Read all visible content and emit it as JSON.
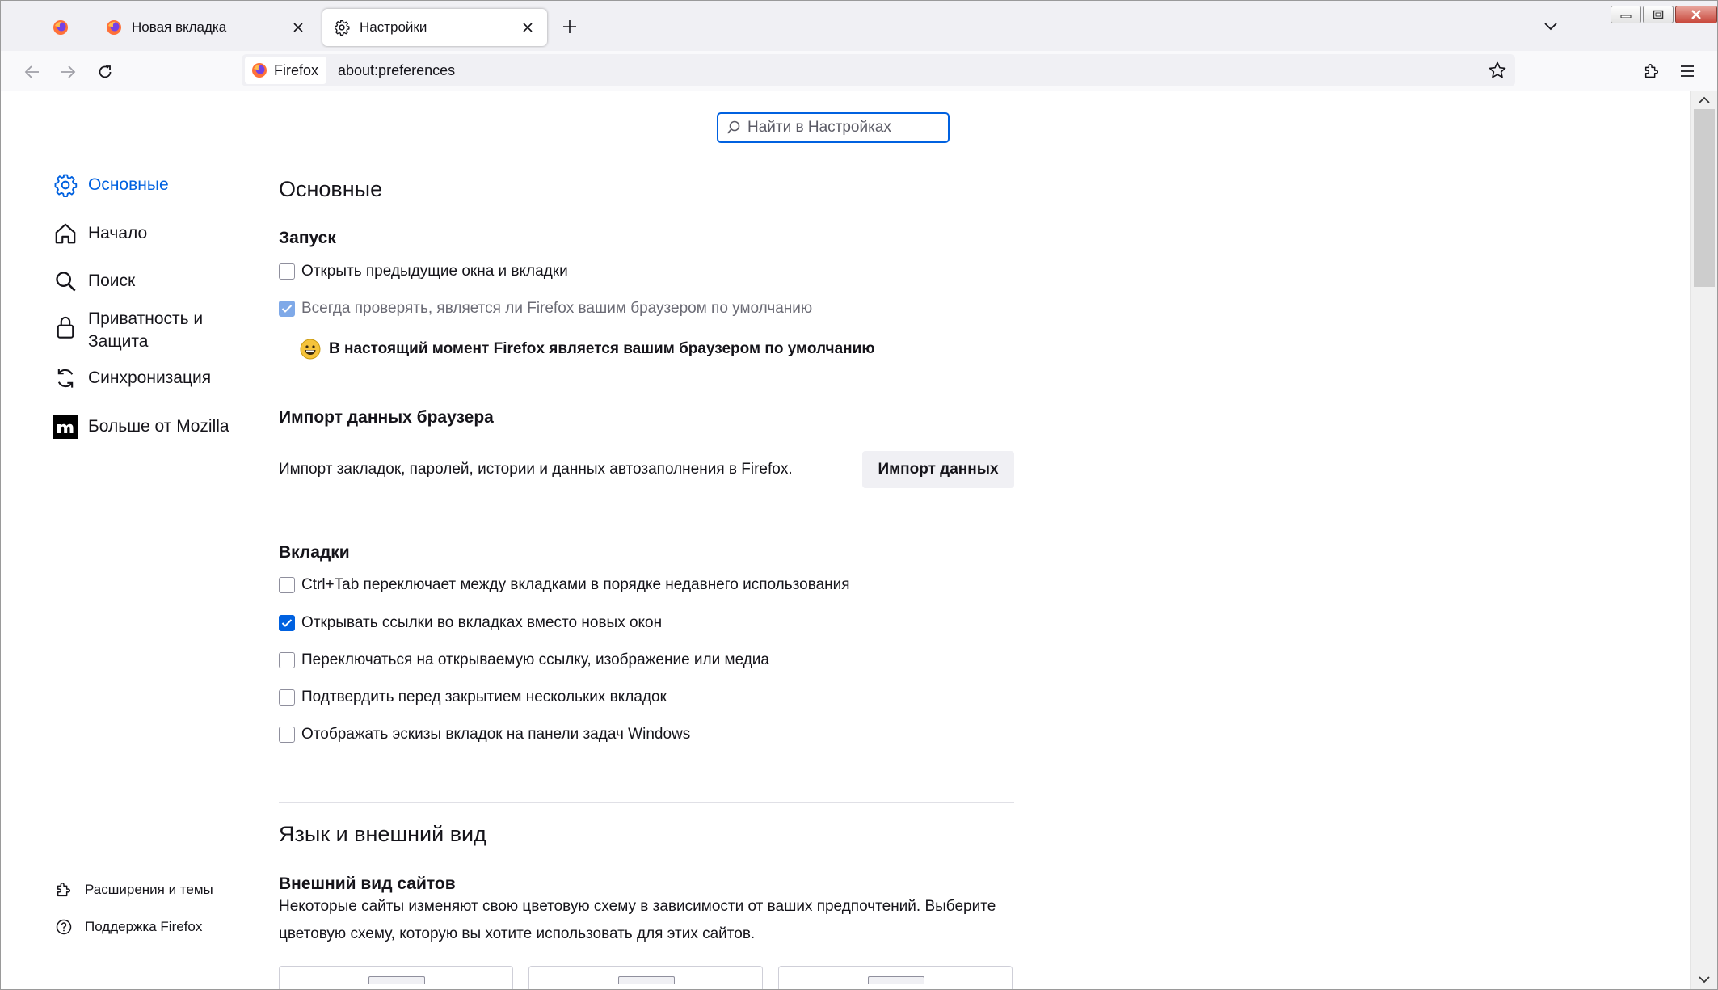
{
  "window": {
    "tabs": [
      {
        "label": "Новая вкладка",
        "active": false
      },
      {
        "label": "Настройки",
        "active": true
      }
    ]
  },
  "navbar": {
    "identity_label": "Firefox",
    "url": "about:preferences"
  },
  "search": {
    "placeholder": "Найти в Настройках"
  },
  "sidebar": {
    "items": [
      {
        "label": "Основные",
        "icon": "gear-icon",
        "selected": true
      },
      {
        "label": "Начало",
        "icon": "home-icon"
      },
      {
        "label": "Поиск",
        "icon": "search-icon"
      },
      {
        "label": "Приватность и Защита",
        "icon": "lock-icon"
      },
      {
        "label": "Синхронизация",
        "icon": "sync-icon"
      },
      {
        "label": "Больше от Mozilla",
        "icon": "mozilla-icon"
      }
    ],
    "footer": [
      {
        "label": "Расширения и темы",
        "icon": "puzzle-icon"
      },
      {
        "label": "Поддержка Firefox",
        "icon": "help-icon"
      }
    ]
  },
  "main": {
    "title": "Основные",
    "startup": {
      "heading": "Запуск",
      "restore_session": {
        "label": "Открыть предыдущие окна и вкладки",
        "checked": false
      },
      "check_default": {
        "label": "Всегда проверять, является ли Firefox вашим браузером по умолчанию",
        "checked": true,
        "disabled": true
      },
      "is_default_text": "В настоящий момент Firefox является вашим браузером по умолчанию"
    },
    "import": {
      "heading": "Импорт данных браузера",
      "description": "Импорт закладок, паролей, истории и данных автозаполнения в Firefox.",
      "button": "Импорт данных"
    },
    "tabs": {
      "heading": "Вкладки",
      "options": [
        {
          "label": "Ctrl+Tab переключает между вкладками в порядке недавнего использования",
          "checked": false
        },
        {
          "label": "Открывать ссылки во вкладках вместо новых окон",
          "checked": true
        },
        {
          "label": "Переключаться на открываемую ссылку, изображение или медиа",
          "checked": false
        },
        {
          "label": "Подтвердить перед закрытием нескольких вкладок",
          "checked": false
        },
        {
          "label": "Отображать эскизы вкладок на панели задач Windows",
          "checked": false
        }
      ]
    },
    "language_title": "Язык и внешний вид",
    "appearance": {
      "heading": "Внешний вид сайтов",
      "description": "Некоторые сайты изменяют свою цветовую схему в зависимости от ваших предпочтений. Выберите цветовую схему, которую вы хотите использовать для этих сайтов."
    }
  },
  "colors": {
    "accent": "#0061e0",
    "tabbar_bg": "#f0f0f4",
    "text": "#15141a"
  }
}
